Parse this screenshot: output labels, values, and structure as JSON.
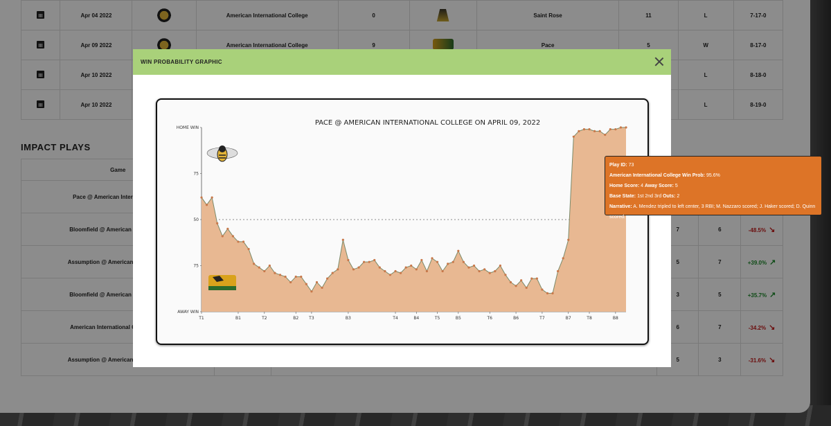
{
  "games_table": [
    {
      "date": "Apr 04 2022",
      "home": "American International College",
      "home_score": "0",
      "away": "Saint Rose",
      "away_score": "11",
      "result": "L",
      "record": "7-17-0"
    },
    {
      "date": "Apr 09 2022",
      "home": "American International College",
      "home_score": "9",
      "away": "Pace",
      "away_score": "5",
      "result": "W",
      "record": "8-17-0"
    },
    {
      "date": "Apr 10 2022",
      "home": "",
      "home_score": "",
      "away": "",
      "away_score": "",
      "result": "L",
      "record": "8-18-0"
    },
    {
      "date": "Apr 10 2022",
      "home": "",
      "home_score": "",
      "away": "",
      "away_score": "",
      "result": "L",
      "record": "8-19-0"
    }
  ],
  "impact": {
    "title": "IMPACT PLAYS",
    "col_game": "Game",
    "rows": [
      {
        "game": "Pace @ American International Co",
        "c1": "",
        "c2": "",
        "wpa": ""
      },
      {
        "game": "Bloomfield @ American International",
        "c1": "7",
        "c2": "6",
        "wpa": "-48.5%",
        "trend": "down"
      },
      {
        "game": "Assumption @ American International",
        "c1": "5",
        "c2": "7",
        "wpa": "+39.0%",
        "trend": "up"
      },
      {
        "game": "Bloomfield @ American International",
        "c1": "3",
        "c2": "5",
        "wpa": "+35.7%",
        "trend": "up"
      },
      {
        "game": "American International College @ St",
        "c1": "6",
        "c2": "7",
        "wpa": "-34.2%",
        "trend": "down"
      },
      {
        "game": "Assumption @ American International",
        "c1": "5",
        "c2": "3",
        "wpa": "-31.6%",
        "trend": "down"
      }
    ]
  },
  "modal": {
    "title": "WIN PROBABILITY GRAPHIC",
    "close_icon": "close-icon"
  },
  "tooltip": {
    "play_id_label": "Play ID:",
    "play_id": "73",
    "winprob_label": "American International College Win Prob:",
    "winprob": "95.6%",
    "home_score_label": "Home Score:",
    "home_score": "4",
    "away_score_label": "Away Score:",
    "away_score": "5",
    "base_label": "Base State:",
    "base": "1st 2nd 3rd",
    "outs_label": "Outs:",
    "outs": "2",
    "narrative_label": "Narrative:",
    "narrative": "A. Mendez tripled to left center, 3 RBI; M. Nazzaro scored; J. Haker scored; D. Quinn scored."
  },
  "chart_data": {
    "type": "area",
    "title": "PACE @ AMERICAN INTERNATIONAL COLLEGE ON APRIL 09, 2022",
    "y_tick_labels": [
      "HOME WIN",
      "75",
      "50",
      "75",
      "AWAY WIN"
    ],
    "y_tick_values": [
      100,
      75,
      50,
      25,
      0
    ],
    "ylim": [
      0,
      100
    ],
    "x_tick_labels": [
      "T1",
      "B1",
      "T2",
      "B2",
      "T3",
      "B3",
      "T4",
      "B4",
      "T5",
      "B5",
      "T6",
      "B6",
      "T7",
      "B7",
      "T8",
      "B8",
      "T9"
    ],
    "x_tick_positions": [
      0,
      7,
      12,
      18,
      21,
      28,
      37,
      41,
      45,
      49,
      55,
      60,
      65,
      70,
      74,
      79,
      93
    ],
    "values": [
      62,
      58,
      62,
      48,
      41,
      45,
      41,
      38,
      38,
      34,
      26,
      24,
      22,
      25,
      21,
      20,
      19,
      16,
      19,
      19,
      15,
      11,
      16,
      13,
      18,
      21,
      23,
      39,
      28,
      23,
      24,
      27,
      27,
      28,
      24,
      22,
      20,
      22,
      21,
      24,
      25,
      23,
      28,
      22,
      29,
      27,
      22,
      26,
      27,
      33,
      27,
      24,
      25,
      22,
      23,
      21,
      22,
      25,
      20,
      16,
      14,
      17,
      13,
      18,
      18,
      12,
      10,
      10,
      22,
      29,
      39,
      95,
      98,
      99,
      99,
      98,
      98,
      96,
      99,
      99,
      100,
      100
    ],
    "fill_color": "#e8b892",
    "line_color": "#7a8a6a",
    "point_color": "#c8784a",
    "midline": 50,
    "home_logo": "hornet-logo",
    "away_logo": "pace-logo"
  }
}
